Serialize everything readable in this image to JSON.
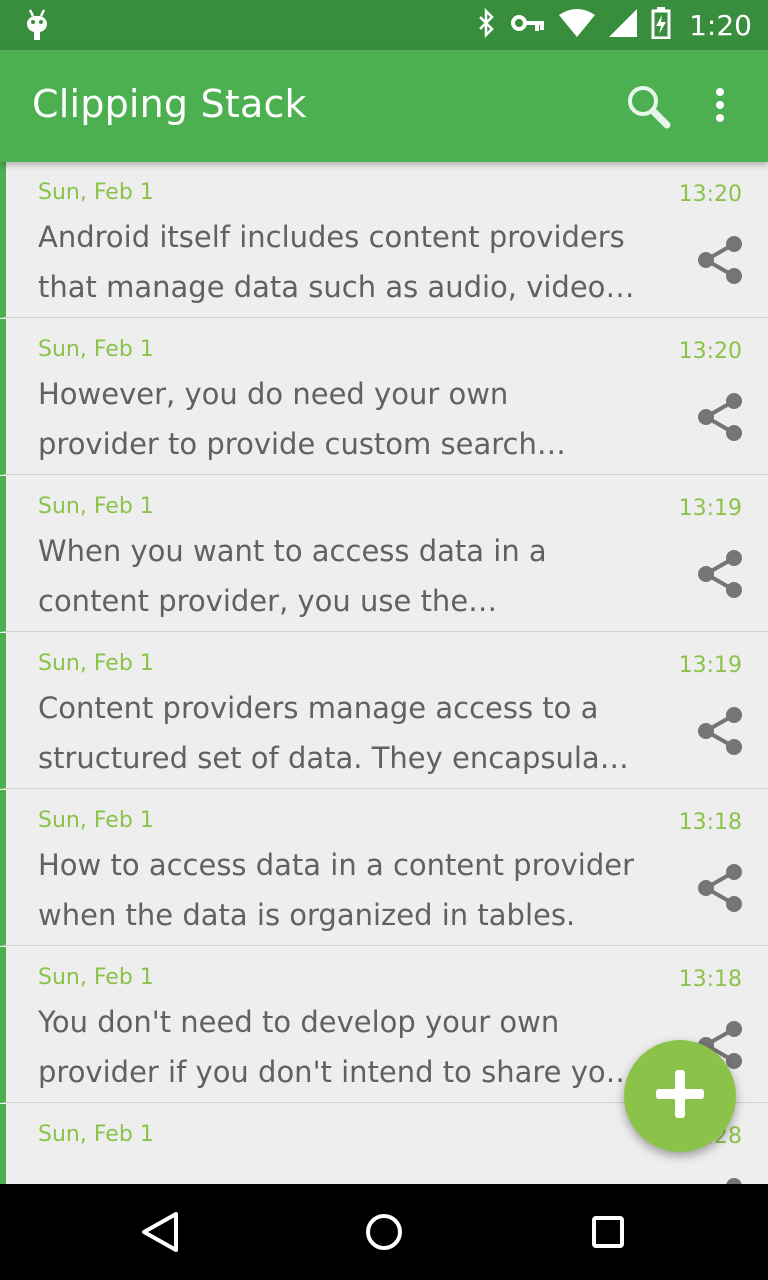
{
  "status_bar": {
    "time": "1:20",
    "icons": [
      "android-icon",
      "bluetooth-icon",
      "key-icon",
      "wifi-icon",
      "signal-icon",
      "battery-charging-icon"
    ]
  },
  "app_bar": {
    "title": "Clipping Stack",
    "actions": [
      "search-icon",
      "overflow-menu-icon"
    ]
  },
  "clips": [
    {
      "date": "Sun, Feb 1",
      "time": "13:20",
      "text": "Android itself includes content providers that manage data such as audio, video, images, and personal contact information."
    },
    {
      "date": "Sun, Feb 1",
      "time": "13:20",
      "text": "However, you do need your own provider to provide custom search suggestions in your own application."
    },
    {
      "date": "Sun, Feb 1",
      "time": "13:19",
      "text": "When you want to access data in a content provider, you use the ContentResolver object."
    },
    {
      "date": "Sun, Feb 1",
      "time": "13:19",
      "text": "Content providers manage access to a structured set of data. They encapsulate the data."
    },
    {
      "date": "Sun, Feb 1",
      "time": "13:18",
      "text": "How to access data in a content provider when the data is organized in tables."
    },
    {
      "date": "Sun, Feb 1",
      "time": "13:18",
      "text": "You don't need to develop your own provider if you don't intend to share your data."
    },
    {
      "date": "Sun, Feb 1",
      "time": "13:28",
      "text": ""
    }
  ],
  "fab": {
    "icon": "add-icon"
  },
  "colors": {
    "status_bar": "#388e3c",
    "app_bar": "#4caf50",
    "accent": "#8bc34a",
    "text": "#616161",
    "background": "#eeeeee"
  }
}
